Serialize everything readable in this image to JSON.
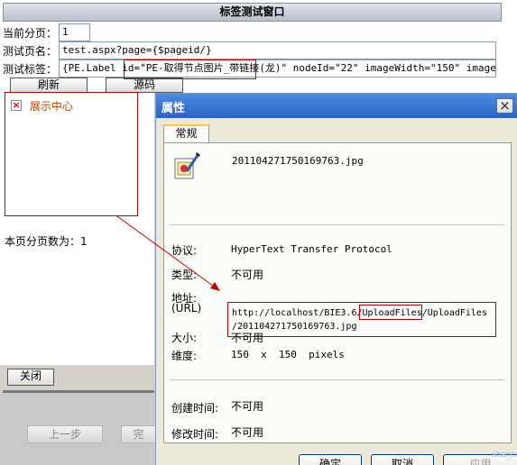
{
  "test_window": {
    "title": "标签测试窗口",
    "current_page_label": "当前分页：",
    "current_page_value": "1",
    "page_name_label": "测试页名：",
    "page_name_value": "test.aspx?page={$pageid/}",
    "tag_label": "测试标签：",
    "tag_value": "{PE.Label id=\"PE-取得节点图片_带链接(龙)\" nodeId=\"22\" imageWidth=\"150\" imageHeig",
    "refresh_label": "刷新",
    "source_label": "源码",
    "preview_link": "展示中心",
    "page_count_text": "本页分页数为：1",
    "close_label": "关闭",
    "prev_step_label": "上一步",
    "finish_partial_label": "完"
  },
  "properties_dialog": {
    "title": "属性",
    "tab_label": "常规",
    "file_name": "201104271750169763.jpg",
    "protocol_label": "协议:",
    "protocol_value": "HyperText Transfer Protocol",
    "type_label": "类型:",
    "type_value": "不可用",
    "address_label": "地址:",
    "address_label_sub": "(URL)",
    "url_line1": "http://localhost/BIE3.6/UploadFiles/UploadFiles",
    "url_line2": "/201104271750169763.jpg",
    "size_label": "大小:",
    "size_value": "不可用",
    "dimensions_label": "维度:",
    "dimensions_value": "150  x  150  pixels",
    "created_label": "创建时间:",
    "created_value": "不可用",
    "modified_label": "修改时间:",
    "modified_value": "不可用",
    "ok_label": "确定",
    "cancel_label": "取消",
    "apply_label": "应用"
  },
  "watermark": "shancun",
  "colors": {
    "annotation_red": "#c00000",
    "dialog_title_blue": "#2a63c9"
  }
}
